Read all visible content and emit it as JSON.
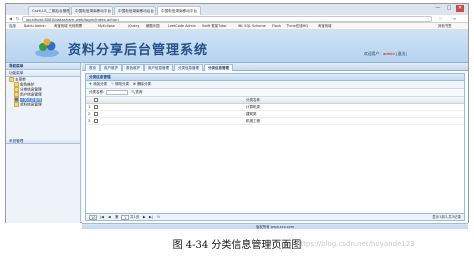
{
  "browser": {
    "tabs": [
      "Cacti.LS_二期后台管理平台",
      "中国电信湖南移动平台",
      "中国电信湖南移动后台",
      "中国电信湖南移动平台"
    ],
    "window_controls": [
      "—",
      "□",
      "✕"
    ],
    "url": "localhost:8080/datashare-web/login/index.action",
    "bookmarks": [
      "应用",
      "Baidu Admin",
      "淘宝商城 代码购票",
      "MyEclipse",
      "jQuery",
      "解题乐园",
      "LeetCode Admin",
      "Swift 框架Tutor",
      "IBL SQL Scheme",
      "Flash",
      "下one在线MQ",
      "淘宝商城",
      "其他书签"
    ]
  },
  "header": {
    "site_title": "资料分享后台管理系统",
    "user_label": "欢迎用户：",
    "user_name": "admin",
    "logout": "[退出]"
  },
  "sidebar": {
    "title": "导航菜单",
    "section": "功能菜单",
    "root": "主菜单",
    "items": [
      "角色维护",
      "分类信息管理",
      "用户信息管理",
      "分类信息管理",
      "资料信息管理"
    ],
    "selected_index": 3,
    "bottom_section": "系统管理"
  },
  "main": {
    "tabs": [
      "首页",
      "用户维护",
      "角色维护",
      "用户信息管理",
      "分类信息管理",
      "分类信息管理"
    ],
    "active_tab_index": 5,
    "grid_title": "分类信息管理",
    "toolbar": [
      "添加分类",
      "修改分类",
      "删除分类"
    ],
    "search_label": "分类名称：",
    "search_button": "查询",
    "column_header": "分类名称",
    "rows": [
      {
        "num": "1",
        "name": "计算机类"
      },
      {
        "num": "2",
        "name": "建筑类"
      },
      {
        "num": "3",
        "name": "机械工程"
      }
    ],
    "pager": {
      "page_size": "10",
      "page_label": "第",
      "page_num": "1",
      "of_label": "共1页",
      "info": "显示1到3,共3记录"
    }
  },
  "footer": {
    "text": "版权所有 www.xxx.com"
  },
  "caption": "图 4-34 分类信息管理页面图",
  "watermark": "https://blog.csdn.net/huyande123",
  "colors": {
    "banner": "#b7d3ef",
    "title": "#26508a",
    "selected": "#3d80d0"
  }
}
